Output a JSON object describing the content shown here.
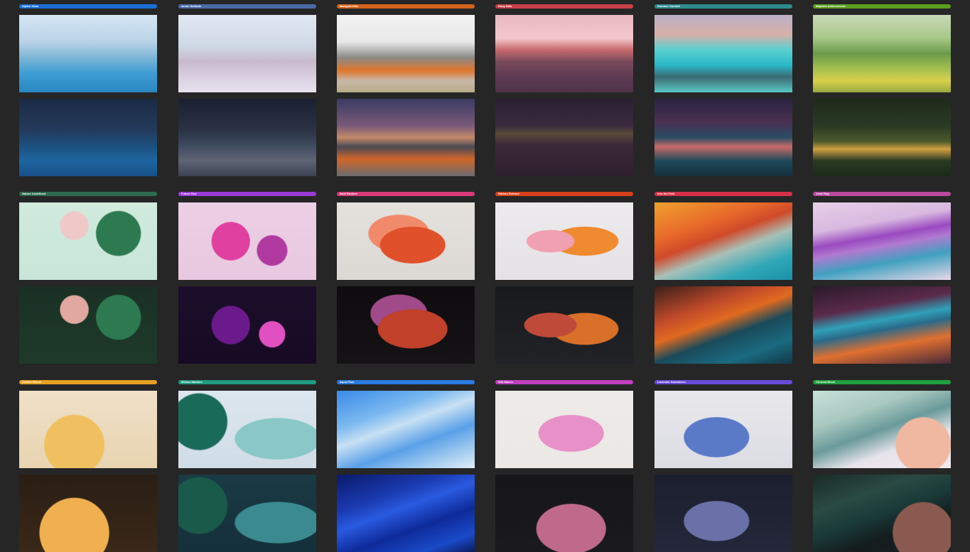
{
  "groups": [
    {
      "label": "Alpine Glow",
      "color": "#1a6fd6",
      "light": "linear-gradient(180deg,#d6e6f3 0%,#b9d3e6 35%,#7eb6d6 55%,#3e9ed4 75%,#2a86c2 100%)",
      "dark": "linear-gradient(180deg,#1a2a44 0%,#243a5c 40%,#1d4f7c 60%,#1e64a0 80%,#17508a 100%)"
    },
    {
      "label": "Arctic Solitude",
      "color": "#4a6aa8",
      "light": "linear-gradient(180deg,#dfe8f1 0%,#cfd8e6 40%,#c9b9cc 60%,#d8cfe0 80%,#e6e2ee 100%)",
      "dark": "linear-gradient(180deg,#1a2030 0%,#2a3244 40%,#3e4a5e 60%,#5e6474 80%,#3c4252 100%)"
    },
    {
      "label": "Marigold Hills",
      "color": "#d4631c",
      "light": "linear-gradient(180deg,#f3f3f3 0%,#e8e8e8 35%,#8a8a86 55%,#e0762c 72%,#c8b8a8 85%,#b8ab8a 100%)",
      "dark": "linear-gradient(180deg,#3a3a62 0%,#7a5a78 35%,#c48a6a 50%,#4a4a54 62%,#d0662a 78%,#6a6a70 100%)"
    },
    {
      "label": "Rosy Hills",
      "color": "#c8404a",
      "light": "linear-gradient(180deg,#e8b8c0 0%,#f3c8cc 30%,#c86a6e 45%,#7a4a5c 60%,#5e3a52 80%,#4e3348 100%)",
      "dark": "linear-gradient(180deg,#2a2032 0%,#3a2a3e 35%,#5a4a3a 45%,#3a2838 60%,#2e2030 100%)"
    },
    {
      "label": "Summer Summit",
      "color": "#2e8a8e",
      "light": "linear-gradient(180deg,#b8b0c8 0%,#d8b0a8 25%,#5ad0d0 45%,#2ab8c8 65%,#3a6a72 80%,#5ac8c4 100%)",
      "dark": "linear-gradient(180deg,#2a2440 0%,#4a3050 30%,#2a4c64 50%,#c86a6a 62%,#1e4a5c 80%,#14303c 100%)"
    },
    {
      "label": "Majestic Achievement",
      "color": "#5aa020",
      "light": "linear-gradient(180deg,#c8d8b8 0%,#a8c888 30%,#6a9a4a 50%,#a8c050 70%,#d8d04a 85%,#9aa840 100%)",
      "dark": "linear-gradient(180deg,#1e2a1a 0%,#2a3a24 35%,#4a5a2a 55%,#d0a040 65%,#2a3a22 80%,#1a2a18 100%)"
    },
    {
      "label": "Nature Undefined",
      "color": "#2e6a4e",
      "light": "radial-gradient(circle at 40% 30%,#f0c8c8 0 14%,transparent 15%),radial-gradient(circle at 72% 40%,#2e7a50 0 20%,transparent 21%),linear-gradient(180deg,#d0eadc 0%,#c8e6d8 100%)",
      "dark": "radial-gradient(circle at 40% 30%,#e0a8a0 0 14%,transparent 15%),radial-gradient(circle at 72% 40%,#2e7a50 0 20%,transparent 21%),linear-gradient(180deg,#1a3024 0%,#1e3a2a 100%)"
    },
    {
      "label": "Future Flux",
      "color": "#9a3ad8",
      "light": "radial-gradient(circle at 38% 50%,#e040a0 0 20%,transparent 21%),radial-gradient(circle at 68% 62%,#b03aa0 0 14%,transparent 15%),linear-gradient(180deg,#ecd0e4 0%,#e8c8e0 100%)",
      "dark": "radial-gradient(circle at 38% 50%,#6a1a8a 0 20%,transparent 21%),radial-gradient(circle at 68% 62%,#e050c0 0 12%,transparent 13%),linear-gradient(180deg,#1a0e2a 0%,#180a24 100%)"
    },
    {
      "label": "Bold Strokes",
      "color": "#d83a7a",
      "light": "radial-gradient(ellipse at 55% 55%,#e0502a 0 30%,transparent 31%),radial-gradient(ellipse at 45% 40%,#f08a6a 0 28%,transparent 29%),linear-gradient(180deg,#e4e0dc 0%,#dcd8d4 100%)",
      "dark": "radial-gradient(ellipse at 55% 55%,#c0402a 0 32%,transparent 33%),radial-gradient(ellipse at 45% 35%,#a04a8a 0 26%,transparent 27%),linear-gradient(180deg,#0e0c0e 0%,#141214 100%)"
    },
    {
      "label": "Ribbon Release",
      "color": "#d8401a",
      "light": "radial-gradient(ellipse at 40% 50%,#f0a0b0 0 20%,transparent 21%),radial-gradient(ellipse at 65% 50%,#f08a30 0 26%,transparent 27%),linear-gradient(180deg,#eceaec 0%,#e4e2e4 100%)",
      "dark": "radial-gradient(ellipse at 40% 50%,#c04a3a 0 22%,transparent 23%),radial-gradient(ellipse at 65% 55%,#d8702a 0 26%,transparent 27%),linear-gradient(180deg,#181a1e 0%,#202226 100%)"
    },
    {
      "label": "Into the Fold",
      "color": "#d8304a",
      "light": "linear-gradient(160deg,#f0a030 0%,#e86a2a 30%,#d04a2a 45%,#a8c0b8 60%,#30a8b8 80%,#1a90a8 100%)",
      "dark": "linear-gradient(160deg,#3a1e1a 0%,#c04a2a 30%,#e06a20 45%,#1a4a5a 60%,#1a6a80 80%,#143848 100%)"
    },
    {
      "label": "Vivid Flag",
      "color": "#b84aa0",
      "light": "linear-gradient(170deg,#e8d0e8 0%,#d8b8e0 30%,#9a4ac0 45%,#b07ad0 55%,#40a0c0 72%,#e8d8e8 100%)",
      "dark": "linear-gradient(170deg,#2a1a2a 0%,#5a2a4a 30%,#30a0b8 45%,#2a6a8a 55%,#e07030 72%,#4a2a3a 100%)"
    },
    {
      "label": "Golden Bloom",
      "color": "#e8a020",
      "light": "radial-gradient(circle at 40% 70%,#f0c060 0 30%,transparent 31%),linear-gradient(180deg,#f0e0c8 0%,#e8d4b0 100%)",
      "dark": "radial-gradient(circle at 40% 75%,#f0b050 0 34%,transparent 35%),linear-gradient(180deg,#2a1e14 0%,#3a2818 100%)"
    },
    {
      "label": "Mellow Marbles",
      "color": "#209a80",
      "light": "radial-gradient(circle at 15% 40%,#1a6a5a 0 22%,transparent 23%),radial-gradient(ellipse at 72% 62%,#8ac8c8 0 30%,transparent 31%),linear-gradient(180deg,#dce6ee 0%,#d0dce6 100%)",
      "dark": "radial-gradient(circle at 15% 40%,#1a5a4a 0 22%,transparent 23%),radial-gradient(ellipse at 72% 62%,#3a8a90 0 30%,transparent 31%),linear-gradient(180deg,#1a3a44 0%,#14303a 100%)"
    },
    {
      "label": "Aqua Flow",
      "color": "#2a7ae0",
      "light": "linear-gradient(160deg,#3a8ae8 0%,#7ab8f0 30%,#c8e0f4 45%,#5aa0e8 65%,#a8cef0 85%,#e0ecf6 100%)",
      "dark": "linear-gradient(160deg,#0a1a6a 0%,#1a3ab0 30%,#2a5ae0 45%,#0e2a9a 65%,#1a4ac8 85%,#0a1a5a 100%)"
    },
    {
      "label": "Silk Waves",
      "color": "#c040c0",
      "light": "radial-gradient(ellipse at 55% 55%,#e890c8 0 30%,transparent 31%),linear-gradient(180deg,#eeeae8 0%,#ece8e6 100%)",
      "dark": "radial-gradient(ellipse at 55% 70%,#c06a8a 0 32%,transparent 33%),linear-gradient(180deg,#161618 0%,#1a1a1c 100%)"
    },
    {
      "label": "Lavender Sandstorm",
      "color": "#6a4ad8",
      "light": "radial-gradient(ellipse at 45% 60%,#5a7ac8 0 30%,transparent 31%),linear-gradient(180deg,#e8e8ec 0%,#dcdce4 100%)",
      "dark": "radial-gradient(ellipse at 45% 60%,#6a70a8 0 30%,transparent 31%),linear-gradient(180deg,#1a1e2e 0%,#24283a 100%)"
    },
    {
      "label": "Chroma Block",
      "color": "#20a040",
      "light": "radial-gradient(circle at 80% 70%,#f0b8a0 0 22%,transparent 23%),linear-gradient(160deg,#c8e0d8 0%,#a8c8c0 30%,#6a9a9a 50%,#e8e4ec 70%,#f0e8ee 100%)",
      "dark": "radial-gradient(circle at 80% 75%,#8a5a50 0 24%,transparent 25%),linear-gradient(160deg,#1a2a24 0%,#2a4a44 30%,#1a3a38 50%,#141c1e 70%,#1a1e22 100%)"
    }
  ]
}
